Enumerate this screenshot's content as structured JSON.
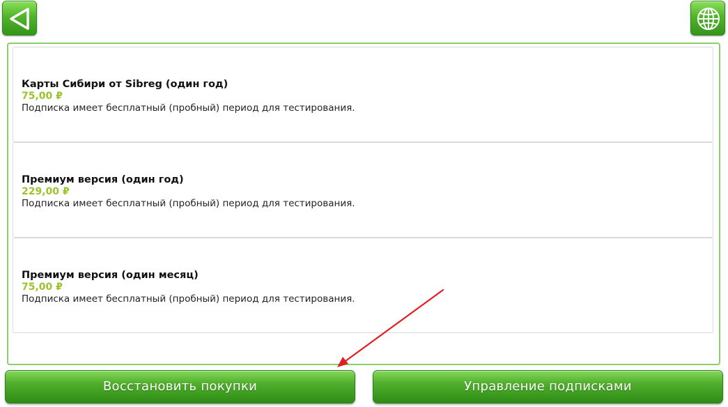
{
  "toolbar": {
    "back_icon": "back-triangle-icon",
    "globe_icon": "globe-icon",
    "accent_color": "#4fae2b"
  },
  "subscriptions": [
    {
      "title": "Карты Сибири от Sibreg (один год)",
      "price": "75,00 ₽",
      "description": "Подписка имеет бесплатный (пробный) период для тестирования."
    },
    {
      "title": "Премиум версия (один год)",
      "price": "229,00 ₽",
      "description": "Подписка имеет бесплатный (пробный) период для тестирования."
    },
    {
      "title": "Премиум версия (один месяц)",
      "price": "75,00 ₽",
      "description": "Подписка имеет бесплатный (пробный) период для тестирования."
    }
  ],
  "actions": {
    "restore_label": "Восстановить покупки",
    "manage_label": "Управление подписками"
  },
  "price_color": "#9ac32c",
  "annotation_arrow_color": "#e02020"
}
